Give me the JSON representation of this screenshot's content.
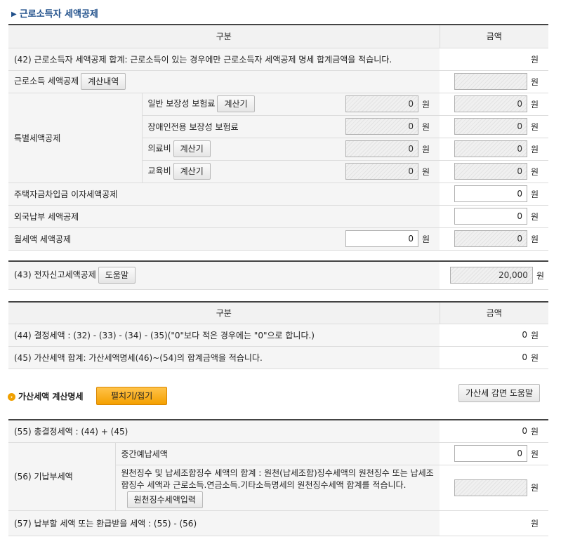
{
  "section_title": "근로소득자 세액공제",
  "table1": {
    "col_label": "구분",
    "col_amount": "금액",
    "row42_label": "(42) 근로소득자 세액공제 합계: 근로소득이 있는 경우에만 근로소득자 세액공제 명세 합계금액을 적습니다.",
    "row42_unit": "원",
    "earned_label": "근로소득 세액공제",
    "earned_button": "계산내역",
    "earned_value": "",
    "special_label": "특별세액공제",
    "general_ins_label": "일반 보장성 보험료",
    "general_ins_button": "계산기",
    "general_ins_input": "0",
    "general_ins_value": "0",
    "disabled_ins_label": "장애인전용 보장성 보험료",
    "disabled_ins_input": "0",
    "disabled_ins_value": "0",
    "medical_label": "의료비",
    "medical_button": "계산기",
    "medical_input": "0",
    "medical_value": "0",
    "education_label": "교육비",
    "education_button": "계산기",
    "education_input": "0",
    "education_value": "0",
    "housing_label": "주택자금차입금 이자세액공제",
    "housing_value": "0",
    "foreign_label": "외국납부 세액공제",
    "foreign_value": "0",
    "rent_label": "월세액 세액공제",
    "rent_input": "0",
    "rent_value": "0",
    "unit": "원"
  },
  "row43": {
    "label": "(43) 전자신고세액공제",
    "button": "도움말",
    "value": "20,000",
    "unit": "원"
  },
  "table2": {
    "col_label": "구분",
    "col_amount": "금액",
    "row44_label": "(44) 결정세액 : (32) - (33) - (34) - (35)(\"0\"보다 적은 경우에는 \"0\"으로 합니다.)",
    "row44_value": "0",
    "row45_label": "(45) 가산세액 합계: 가산세액명세(46)~(54)의 합계금액을 적습니다.",
    "row45_value": "0",
    "unit": "원"
  },
  "penalty": {
    "title": "가산세액 계산명세",
    "toggle_button": "펼치기/접기",
    "help_button": "가산세 감면 도움말"
  },
  "table3": {
    "row55_label": "(55) 총결정세액 : (44) + (45)",
    "row55_value": "0",
    "row56_label": "(56) 기납부세액",
    "interim_label": "중간예납세액",
    "interim_value": "0",
    "withholding_label": "원천징수 및 납세조합징수 세액의 합계 : 원천(납세조합)징수세액의 원천징수 또는 납세조합징수 세액과 근로소득.연금소득.기타소득명세의 원천징수세액 합계를 적습니다.",
    "withholding_button": "원천징수세액입력",
    "withholding_value": "",
    "row57_label": "(57) 납부할 세액 또는 환급받을 세액 : (55) - (56)",
    "unit": "원"
  }
}
